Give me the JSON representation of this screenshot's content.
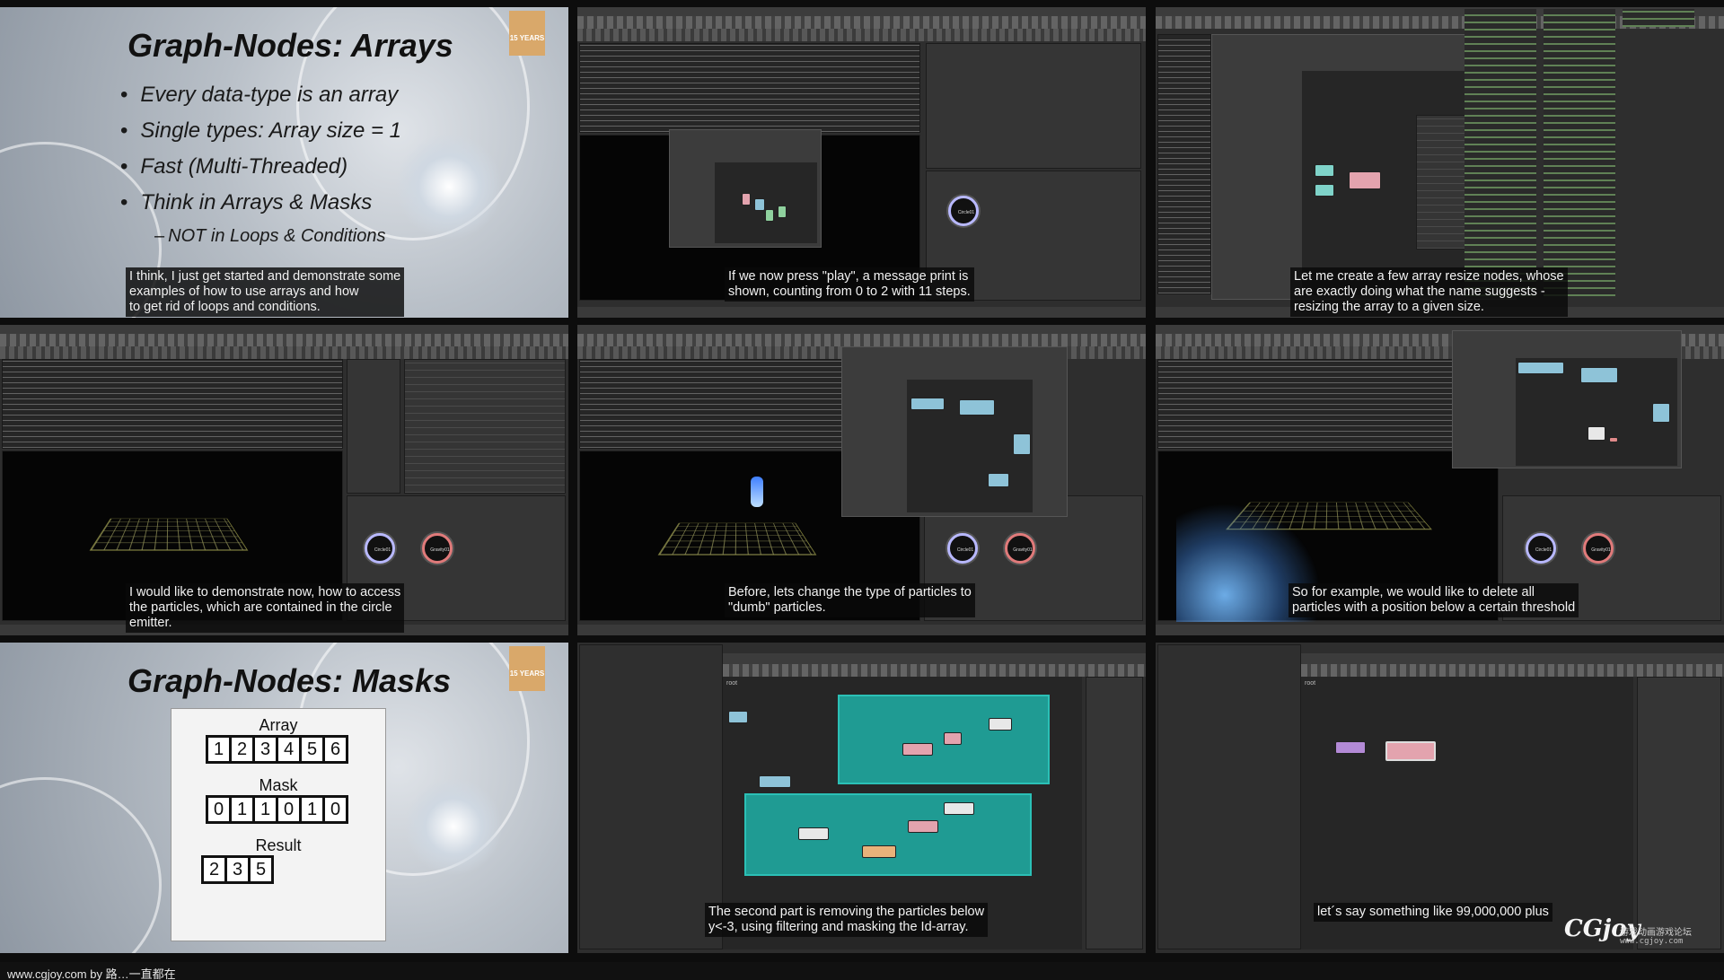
{
  "frames": [
    {
      "id": "arrays-slide",
      "kind": "slide",
      "caption": "I think, I just get started and demonstrate some\nexamples of how to use arrays and how\nto get rid of loops and conditions."
    },
    {
      "id": "play-message",
      "kind": "app",
      "caption": "If we now press \"play\", a message print is\nshown, counting from 0 to 2 with 11 steps."
    },
    {
      "id": "resize-nodes",
      "kind": "app",
      "caption": "Let me create a few array resize nodes, whose\nare exactly doing what the name suggests -\nresizing the array to a given size."
    },
    {
      "id": "access-particles",
      "kind": "app",
      "caption": "I would like to demonstrate now, how to access\nthe particles, which are contained in the circle\nemitter."
    },
    {
      "id": "dumb-particles",
      "kind": "app",
      "caption": "Before, lets change the type of particles to\n\"dumb\" particles."
    },
    {
      "id": "delete-particles",
      "kind": "app",
      "caption": "So for example, we would like to delete all\nparticles with a position below a certain threshold"
    },
    {
      "id": "masks-slide",
      "kind": "slide",
      "caption": ""
    },
    {
      "id": "filtering-mask",
      "kind": "app",
      "caption": "The second part is removing the particles below\ny<-3, using filtering and masking the Id-array."
    },
    {
      "id": "large-number",
      "kind": "app",
      "caption": "let´s say something like 99,000,000 plus"
    }
  ],
  "slide_arrays": {
    "title": "Graph-Nodes: Arrays",
    "badge": "15 YEARS",
    "bullets": [
      "Every data-type is an array",
      "Single types: Array size = 1",
      "Fast (Multi-Threaded)",
      "Think in Arrays & Masks"
    ],
    "sub_bullet": "NOT in Loops & Conditions"
  },
  "slide_masks": {
    "title": "Graph-Nodes: Masks",
    "badge": "15 YEARS",
    "array_label": "Array",
    "array_values": [
      "1",
      "2",
      "3",
      "4",
      "5",
      "6"
    ],
    "mask_label": "Mask",
    "mask_values": [
      "0",
      "1",
      "1",
      "0",
      "1",
      "0"
    ],
    "result_label": "Result",
    "result_values": [
      "2",
      "3",
      "5"
    ]
  },
  "emitters": {
    "circle": "Circle01",
    "gravity": "Gravity01"
  },
  "graph": {
    "root_label": "root"
  },
  "footer": {
    "text": "www.cgjoy.com by 路…一直都在"
  },
  "watermark": {
    "logo": "CGjoy",
    "subtitle": "游戏动画游戏论坛",
    "url": "www.cgjoy.com"
  }
}
